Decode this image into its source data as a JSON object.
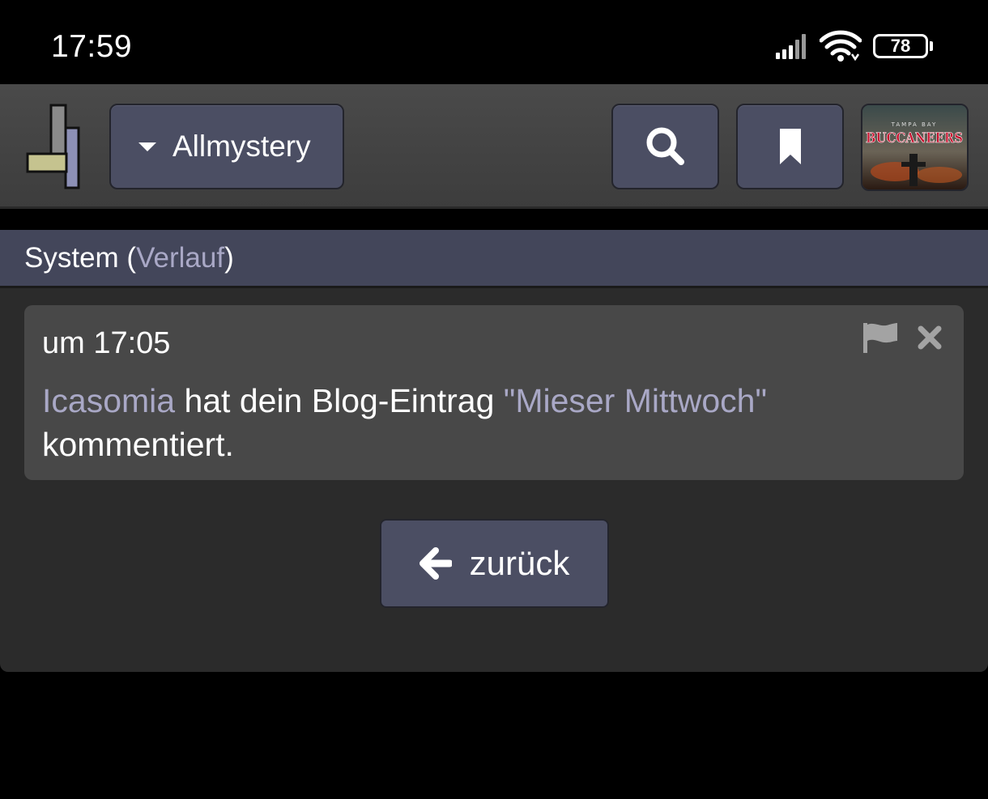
{
  "status": {
    "time": "17:59",
    "battery": "78",
    "battery_level_percent": 78
  },
  "nav": {
    "site_label": "Allmystery",
    "avatar_text_top": "TAMPA BAY",
    "avatar_text_main": "BUCCANEERS"
  },
  "section": {
    "title": "System",
    "open_paren": " (",
    "link": "Verlauf",
    "close_paren": ")"
  },
  "notification": {
    "time": "um 17:05",
    "user": "Icasomia",
    "text_mid": " hat dein Blog-Eintrag ",
    "blog_title": "\"Mieser Mittwoch\"",
    "text_end": " kommentiert."
  },
  "back": {
    "label": "zurück"
  },
  "colors": {
    "accent_link": "#a9a8c6",
    "button_bg": "#4b4e63",
    "header_bg": "#43465a"
  },
  "icons": [
    "signal-icon",
    "wifi-icon",
    "battery-icon",
    "logo-icon",
    "caret-down-icon",
    "search-icon",
    "bookmark-icon",
    "flag-icon",
    "close-icon",
    "arrow-left-icon"
  ]
}
